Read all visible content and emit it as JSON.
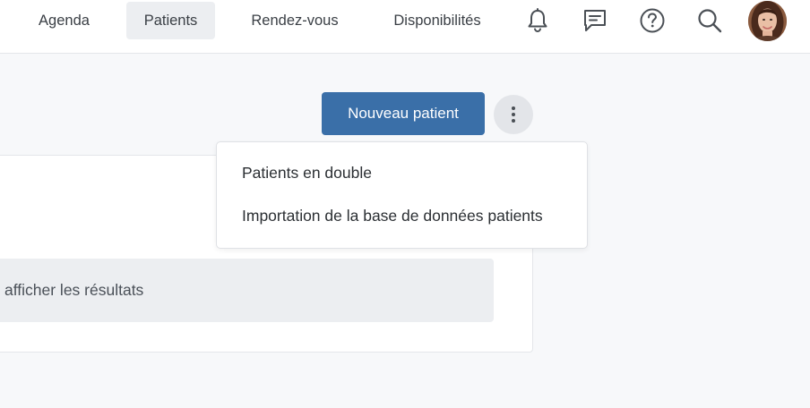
{
  "nav": {
    "tabs": [
      {
        "label": "Agenda",
        "active": false
      },
      {
        "label": "Patients",
        "active": true
      },
      {
        "label": "Rendez-vous",
        "active": false
      },
      {
        "label": "Disponibilités",
        "active": false
      }
    ],
    "icons": [
      "bell-icon",
      "message-icon",
      "help-icon",
      "search-icon"
    ]
  },
  "toolbar": {
    "new_patient_label": "Nouveau patient"
  },
  "menu": {
    "items": [
      "Patients en double",
      "Importation de la base de données patients"
    ]
  },
  "results": {
    "empty_text": "afficher les résultats"
  },
  "colors": {
    "primary": "#3a6fa8",
    "active_tab_bg": "#eceef1",
    "page_bg": "#f7f8fa"
  }
}
